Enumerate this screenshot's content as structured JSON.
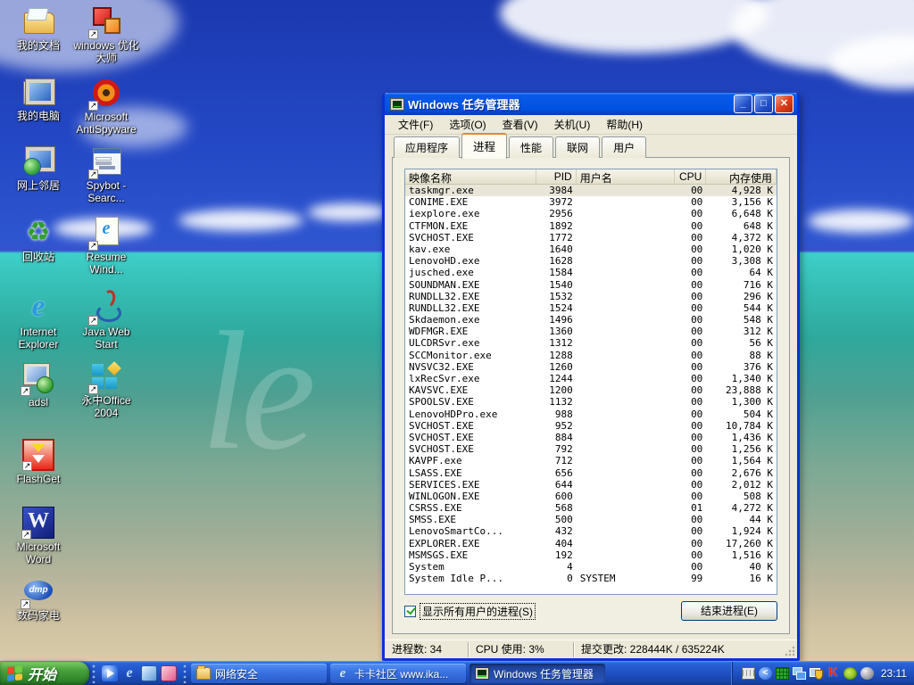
{
  "desktop": {
    "watermark": "le",
    "icons": [
      {
        "label": "我的文档",
        "icon": "my-documents-icon",
        "art": "my-documents",
        "shortcut": false,
        "col": 0,
        "row": 0
      },
      {
        "label": "我的电脑",
        "icon": "my-computer-icon",
        "art": "my-computer",
        "shortcut": false,
        "col": 0,
        "row": 1
      },
      {
        "label": "网上邻居",
        "icon": "network-places-icon",
        "art": "network",
        "shortcut": false,
        "col": 0,
        "row": 2
      },
      {
        "label": "回收站",
        "icon": "recycle-bin-icon",
        "art": "recycle",
        "glyph": "♻",
        "shortcut": false,
        "col": 0,
        "row": 3
      },
      {
        "label": "Internet\nExplorer",
        "icon": "internet-explorer-icon",
        "art": "ie",
        "glyph": "e",
        "shortcut": false,
        "col": 0,
        "row": 4
      },
      {
        "label": "adsl",
        "icon": "adsl-icon",
        "art": "adsl",
        "shortcut": true,
        "col": 0,
        "row": 5
      },
      {
        "label": "FlashGet",
        "icon": "flashget-icon",
        "art": "flashget",
        "shortcut": true,
        "col": 0,
        "row": 6
      },
      {
        "label": "Microsoft\nWord",
        "icon": "word-icon",
        "art": "word",
        "shortcut": true,
        "col": 0,
        "row": 7
      },
      {
        "label": "数码家电",
        "icon": "dmp-icon",
        "art": "dmp",
        "shortcut": true,
        "col": 0,
        "row": 8
      },
      {
        "label": "windows 优化\n大师",
        "icon": "youhua-dashi-icon",
        "art": "cubes",
        "shortcut": true,
        "col": 1,
        "row": 0
      },
      {
        "label": "Microsoft\nAntiSpyware",
        "icon": "antispyware-icon",
        "art": "target",
        "shortcut": true,
        "col": 1,
        "row": 1
      },
      {
        "label": "Spybot -\nSearc...",
        "icon": "spybot-icon",
        "art": "spybot",
        "shortcut": true,
        "col": 1,
        "row": 2
      },
      {
        "label": "Resume\nWind...",
        "icon": "resume-icon",
        "art": "resume",
        "shortcut": true,
        "col": 1,
        "row": 3
      },
      {
        "label": "Java Web\nStart",
        "icon": "java-icon",
        "art": "java",
        "shortcut": true,
        "col": 1,
        "row": 4
      },
      {
        "label": "永中Office\n2004",
        "icon": "yongzhong-office-icon",
        "art": "office",
        "shortcut": true,
        "col": 1,
        "row": 5
      }
    ]
  },
  "window": {
    "title": "Windows 任务管理器",
    "menus": [
      "文件(F)",
      "选项(O)",
      "查看(V)",
      "关机(U)",
      "帮助(H)"
    ],
    "tabs": [
      {
        "label": "应用程序",
        "active": false
      },
      {
        "label": "进程",
        "active": true
      },
      {
        "label": "性能",
        "active": false
      },
      {
        "label": "联网",
        "active": false
      },
      {
        "label": "用户",
        "active": false
      }
    ],
    "columns": [
      "映像名称",
      "PID",
      "用户名",
      "CPU",
      "内存使用"
    ],
    "processes": [
      {
        "name": "taskmgr.exe",
        "pid": "3984",
        "user": "",
        "cpu": "00",
        "mem": "4,928 K",
        "selected": true
      },
      {
        "name": "CONIME.EXE",
        "pid": "3972",
        "user": "",
        "cpu": "00",
        "mem": "3,156 K"
      },
      {
        "name": "iexplore.exe",
        "pid": "2956",
        "user": "",
        "cpu": "00",
        "mem": "6,648 K"
      },
      {
        "name": "CTFMON.EXE",
        "pid": "1892",
        "user": "",
        "cpu": "00",
        "mem": "648 K"
      },
      {
        "name": "SVCHOST.EXE",
        "pid": "1772",
        "user": "",
        "cpu": "00",
        "mem": "4,372 K"
      },
      {
        "name": "kav.exe",
        "pid": "1640",
        "user": "",
        "cpu": "00",
        "mem": "1,020 K"
      },
      {
        "name": "LenovoHD.exe",
        "pid": "1628",
        "user": "",
        "cpu": "00",
        "mem": "3,308 K"
      },
      {
        "name": "jusched.exe",
        "pid": "1584",
        "user": "",
        "cpu": "00",
        "mem": "64 K"
      },
      {
        "name": "SOUNDMAN.EXE",
        "pid": "1540",
        "user": "",
        "cpu": "00",
        "mem": "716 K"
      },
      {
        "name": "RUNDLL32.EXE",
        "pid": "1532",
        "user": "",
        "cpu": "00",
        "mem": "296 K"
      },
      {
        "name": "RUNDLL32.EXE",
        "pid": "1524",
        "user": "",
        "cpu": "00",
        "mem": "544 K"
      },
      {
        "name": "Skdaemon.exe",
        "pid": "1496",
        "user": "",
        "cpu": "00",
        "mem": "548 K"
      },
      {
        "name": "WDFMGR.EXE",
        "pid": "1360",
        "user": "",
        "cpu": "00",
        "mem": "312 K"
      },
      {
        "name": "ULCDRSvr.exe",
        "pid": "1312",
        "user": "",
        "cpu": "00",
        "mem": "56 K"
      },
      {
        "name": "SCCMonitor.exe",
        "pid": "1288",
        "user": "",
        "cpu": "00",
        "mem": "88 K"
      },
      {
        "name": "NVSVC32.EXE",
        "pid": "1260",
        "user": "",
        "cpu": "00",
        "mem": "376 K"
      },
      {
        "name": "lxRecSvr.exe",
        "pid": "1244",
        "user": "",
        "cpu": "00",
        "mem": "1,340 K"
      },
      {
        "name": "KAVSVC.EXE",
        "pid": "1200",
        "user": "",
        "cpu": "00",
        "mem": "23,888 K"
      },
      {
        "name": "SPOOLSV.EXE",
        "pid": "1132",
        "user": "",
        "cpu": "00",
        "mem": "1,300 K"
      },
      {
        "name": "LenovoHDPro.exe",
        "pid": "988",
        "user": "",
        "cpu": "00",
        "mem": "504 K"
      },
      {
        "name": "SVCHOST.EXE",
        "pid": "952",
        "user": "",
        "cpu": "00",
        "mem": "10,784 K"
      },
      {
        "name": "SVCHOST.EXE",
        "pid": "884",
        "user": "",
        "cpu": "00",
        "mem": "1,436 K"
      },
      {
        "name": "SVCHOST.EXE",
        "pid": "792",
        "user": "",
        "cpu": "00",
        "mem": "1,256 K"
      },
      {
        "name": "KAVPF.exe",
        "pid": "712",
        "user": "",
        "cpu": "00",
        "mem": "1,564 K"
      },
      {
        "name": "LSASS.EXE",
        "pid": "656",
        "user": "",
        "cpu": "00",
        "mem": "2,676 K"
      },
      {
        "name": "SERVICES.EXE",
        "pid": "644",
        "user": "",
        "cpu": "00",
        "mem": "2,012 K"
      },
      {
        "name": "WINLOGON.EXE",
        "pid": "600",
        "user": "",
        "cpu": "00",
        "mem": "508 K"
      },
      {
        "name": "CSRSS.EXE",
        "pid": "568",
        "user": "",
        "cpu": "01",
        "mem": "4,272 K"
      },
      {
        "name": "SMSS.EXE",
        "pid": "500",
        "user": "",
        "cpu": "00",
        "mem": "44 K"
      },
      {
        "name": "LenovoSmartCo...",
        "pid": "432",
        "user": "",
        "cpu": "00",
        "mem": "1,924 K"
      },
      {
        "name": "EXPLORER.EXE",
        "pid": "404",
        "user": "",
        "cpu": "00",
        "mem": "17,260 K"
      },
      {
        "name": "MSMSGS.EXE",
        "pid": "192",
        "user": "",
        "cpu": "00",
        "mem": "1,516 K"
      },
      {
        "name": "System",
        "pid": "4",
        "user": "",
        "cpu": "00",
        "mem": "40 K"
      },
      {
        "name": "System Idle P...",
        "pid": "0",
        "user": "SYSTEM",
        "cpu": "99",
        "mem": "16 K"
      }
    ],
    "show_all_label": "显示所有用户的进程(S)",
    "show_all_checked": true,
    "end_process_label": "结束进程(E)",
    "caption_buttons": {
      "minimize": "_",
      "maximize": "□",
      "close": "✕"
    },
    "status": {
      "processes": "进程数: 34",
      "cpu": "CPU 使用: 3%",
      "commit": "提交更改: 228444K / 635224K"
    }
  },
  "taskbar": {
    "start_label": "开始",
    "quick_launch": [
      {
        "icon": "media-player-icon",
        "art": "wmp"
      },
      {
        "icon": "ie-quicklaunch-icon",
        "art": "ie2",
        "glyph": "e"
      },
      {
        "icon": "outlook-icon",
        "art": "outlook"
      },
      {
        "icon": "media-app-icon",
        "art": "pink"
      }
    ],
    "buttons": [
      {
        "label": "网络安全",
        "icon": "folder-icon",
        "art": "folder",
        "active": false
      },
      {
        "label": "卡卡社区 www.ika...",
        "icon": "ie-page-icon",
        "art": "ie3",
        "glyph": "e",
        "active": false
      },
      {
        "label": "Windows 任务管理器",
        "icon": "task-manager-icon",
        "art": "tman",
        "active": true
      }
    ],
    "tray_icons": [
      {
        "icon": "keyboard-ime-icon",
        "art": "keyboard"
      },
      {
        "icon": "collapse-chevron-icon",
        "art": "chevron",
        "glyph": "<"
      },
      {
        "icon": "green-grid-icon",
        "art": "grid"
      },
      {
        "icon": "network-computers-icon",
        "art": "netmon"
      },
      {
        "icon": "pc-shield-icon",
        "art": "shieldpc"
      },
      {
        "icon": "kaspersky-icon",
        "art": "kav",
        "glyph": "K"
      },
      {
        "icon": "nvidia-icon",
        "art": "nvidia"
      },
      {
        "icon": "volume-sphere-icon",
        "art": "sphere"
      }
    ],
    "clock": "23:11"
  },
  "colors": {
    "titlebar_blue": "#0656e6",
    "dialog_beige": "#ece9d8",
    "tab_accent_orange": "#e6862c",
    "start_green": "#2e832a",
    "check_green": "#21a121",
    "close_red": "#e0401c"
  }
}
